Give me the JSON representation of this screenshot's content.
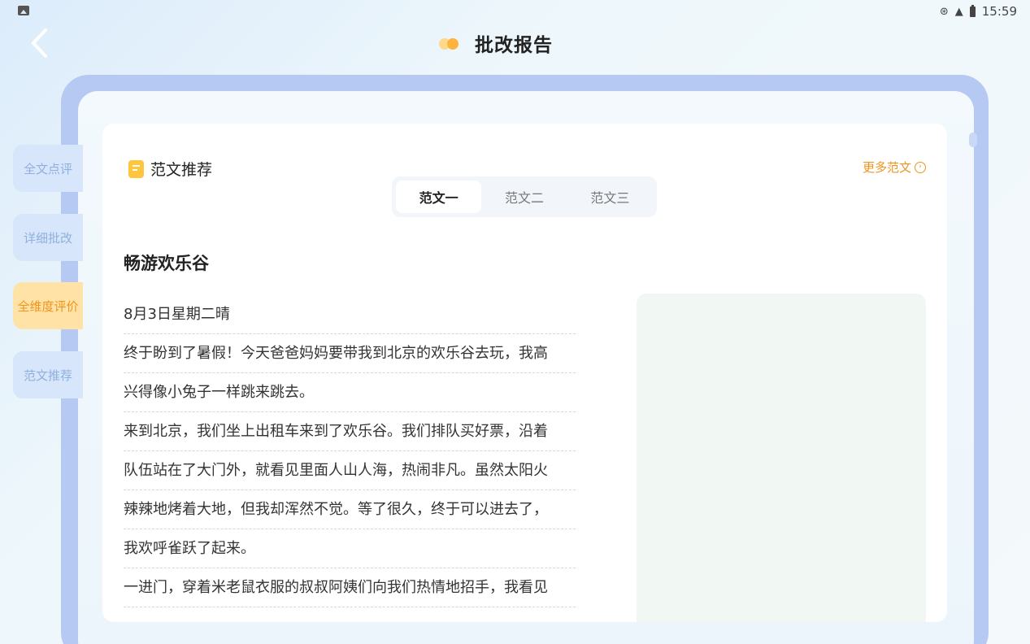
{
  "status_bar": {
    "time": "15:59"
  },
  "header": {
    "title": "批改报告"
  },
  "sidebar": {
    "items": [
      {
        "label": "全文点评"
      },
      {
        "label": "详细批改"
      },
      {
        "label": "全维度评价"
      },
      {
        "label": "范文推荐"
      }
    ]
  },
  "section": {
    "title": "范文推荐",
    "more_label": "更多范文"
  },
  "tabs": [
    {
      "label": "范文一"
    },
    {
      "label": "范文二"
    },
    {
      "label": "范文三"
    }
  ],
  "essay": {
    "title": "畅游欢乐谷",
    "lines": [
      "8月3日星期二晴",
      "终于盼到了暑假！今天爸爸妈妈要带我到北京的欢乐谷去玩，我高",
      "兴得像小兔子一样跳来跳去。",
      "来到北京，我们坐上出租车来到了欢乐谷。我们排队买好票，沿着",
      "队伍站在了大门外，就看见里面人山人海，热闹非凡。虽然太阳火",
      "辣辣地烤着大地，但我却浑然不觉。等了很久，终于可以进去了，",
      "我欢呼雀跃了起来。",
      "一进门，穿着米老鼠衣服的叔叔阿姨们向我们热情地招手，我看见"
    ]
  },
  "colors": {
    "accent": "#f0941e",
    "frame": "#b6c9f2",
    "sidebar_inactive": "#d7e6fb",
    "sidebar_active": "#ffe3a6"
  }
}
